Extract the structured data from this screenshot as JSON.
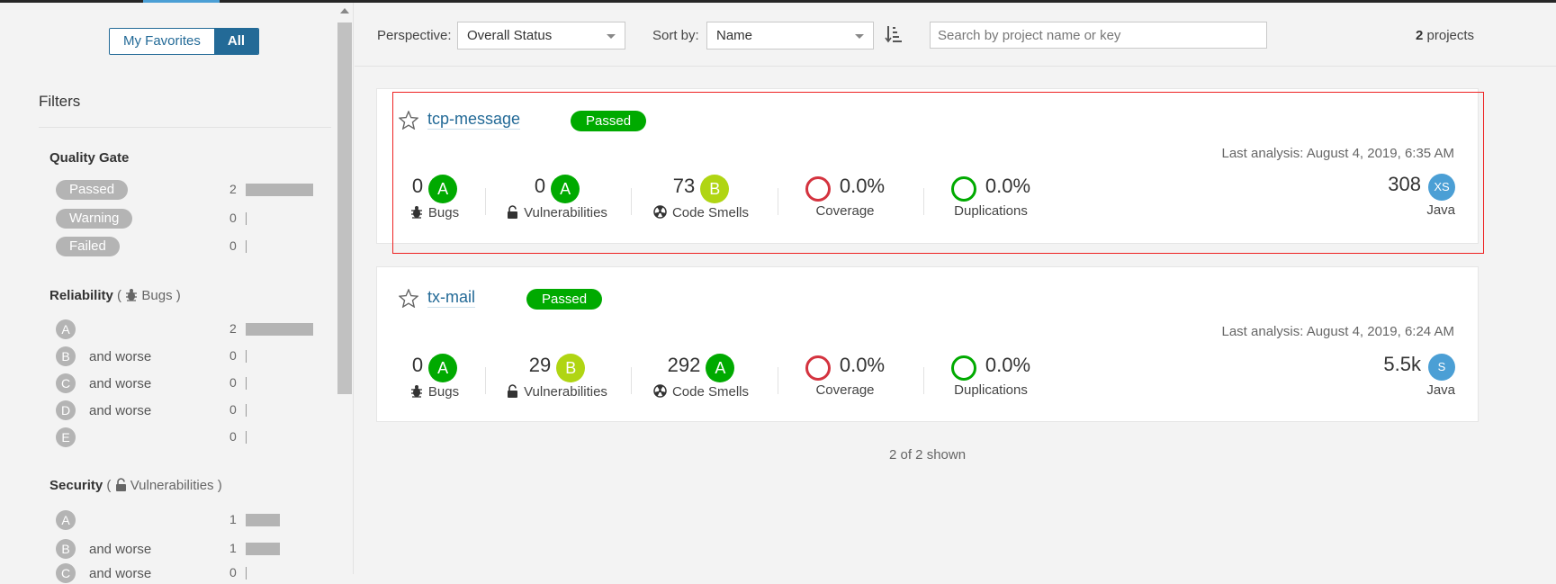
{
  "toggle": {
    "favorites": "My Favorites",
    "all": "All"
  },
  "filters": {
    "title": "Filters",
    "quality_gate": {
      "title": "Quality Gate",
      "items": [
        {
          "label": "Passed",
          "count": "2"
        },
        {
          "label": "Warning",
          "count": "0"
        },
        {
          "label": "Failed",
          "count": "0"
        }
      ]
    },
    "reliability": {
      "title": "Reliability",
      "sub": "Bugs",
      "items": [
        {
          "grade": "A",
          "label": "",
          "count": "2"
        },
        {
          "grade": "B",
          "label": "and worse",
          "count": "0"
        },
        {
          "grade": "C",
          "label": "and worse",
          "count": "0"
        },
        {
          "grade": "D",
          "label": "and worse",
          "count": "0"
        },
        {
          "grade": "E",
          "label": "",
          "count": "0"
        }
      ]
    },
    "security": {
      "title": "Security",
      "sub": "Vulnerabilities",
      "items": [
        {
          "grade": "A",
          "label": "",
          "count": "1"
        },
        {
          "grade": "B",
          "label": "and worse",
          "count": "1"
        },
        {
          "grade": "C",
          "label": "and worse",
          "count": "0"
        }
      ]
    }
  },
  "header": {
    "perspective_label": "Perspective:",
    "perspective_value": "Overall Status",
    "sortby_label": "Sort by:",
    "sortby_value": "Name",
    "search_placeholder": "Search by project name or key",
    "project_count": "2",
    "project_count_suffix": "projects"
  },
  "projects": [
    {
      "name": "tcp-message",
      "gate": "Passed",
      "last_analysis": "Last analysis: August 4, 2019, 6:35 AM",
      "bugs": "0",
      "bugs_grade": "A",
      "bugs_label": "Bugs",
      "vulns": "0",
      "vulns_grade": "A",
      "vulns_label": "Vulnerabilities",
      "smells": "73",
      "smells_grade": "B",
      "smells_label": "Code Smells",
      "coverage": "0.0%",
      "coverage_label": "Coverage",
      "duplications": "0.0%",
      "duplications_label": "Duplications",
      "size": "308",
      "size_class": "XS",
      "language": "Java"
    },
    {
      "name": "tx-mail",
      "gate": "Passed",
      "last_analysis": "Last analysis: August 4, 2019, 6:24 AM",
      "bugs": "0",
      "bugs_grade": "A",
      "bugs_label": "Bugs",
      "vulns": "29",
      "vulns_grade": "B",
      "vulns_label": "Vulnerabilities",
      "smells": "292",
      "smells_grade": "A",
      "smells_label": "Code Smells",
      "coverage": "0.0%",
      "coverage_label": "Coverage",
      "duplications": "0.0%",
      "duplications_label": "Duplications",
      "size": "5.5k",
      "size_class": "S",
      "language": "Java"
    }
  ],
  "footer": {
    "shown": "2 of 2 shown"
  },
  "colors": {
    "accent": "#236a97",
    "passed": "#00aa00",
    "grade_b": "#b0d513",
    "coverage_ring": "#d4333f",
    "size_badge": "#4b9fd5",
    "highlight": "#ee2222"
  }
}
